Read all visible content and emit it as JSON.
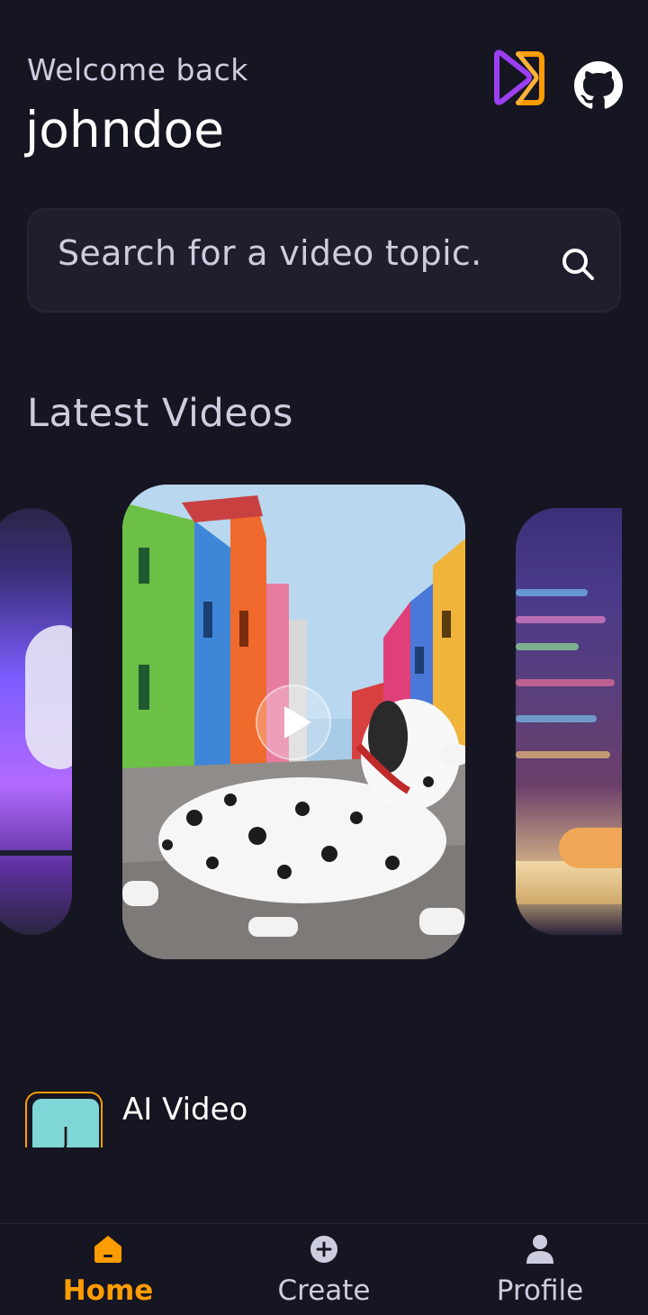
{
  "header": {
    "welcome": "Welcome back",
    "username": "johndoe"
  },
  "icons": {
    "logo": "app-logo-icon",
    "github": "github-icon",
    "search": "search-icon",
    "play": "play-icon"
  },
  "search": {
    "placeholder": "Search for a video topic."
  },
  "latest": {
    "title": "Latest Videos",
    "cards": [
      {
        "name": "ai-robot-video-thumbnail"
      },
      {
        "name": "dalmatian-dog-video-thumbnail"
      },
      {
        "name": "coding-keyboard-video-thumbnail"
      }
    ]
  },
  "trending": {
    "items": [
      {
        "avatar_letter": "J",
        "title": "AI Video"
      }
    ]
  },
  "tabs": [
    {
      "label": "Home",
      "icon": "home-icon",
      "active": true
    },
    {
      "label": "Create",
      "icon": "plus-circle-icon",
      "active": false
    },
    {
      "label": "Profile",
      "icon": "profile-icon",
      "active": false
    }
  ],
  "colors": {
    "background": "#161622",
    "accent": "#ff9c01",
    "muted_text": "#cdcde0",
    "surface": "#1e1e2d",
    "logo_purple": "#9b3ff0"
  }
}
